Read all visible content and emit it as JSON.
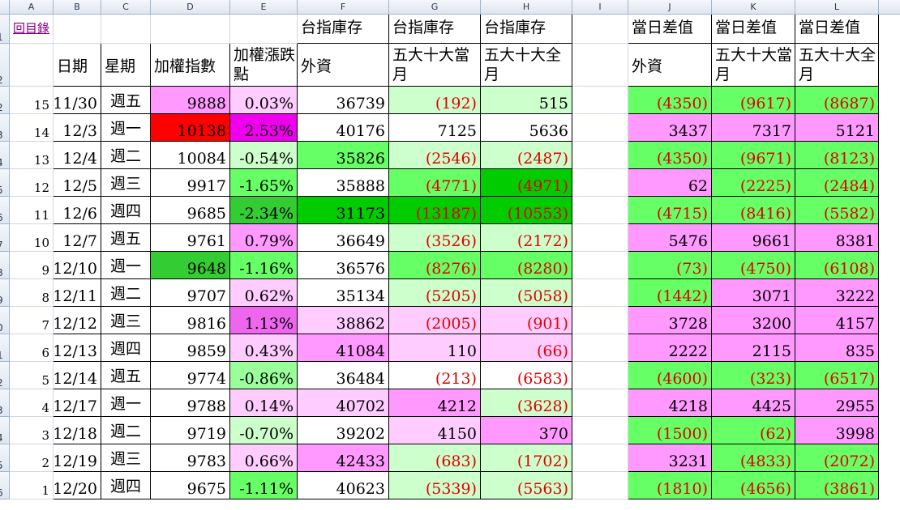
{
  "col_headers": [
    "A",
    "B",
    "C",
    "D",
    "E",
    "F",
    "G",
    "H",
    "I",
    "J",
    "K",
    "L"
  ],
  "row_headers": [
    "1",
    "2",
    "2",
    "3",
    "4",
    "5",
    "6",
    "7",
    "8",
    "9",
    "0",
    "1",
    "2",
    "3",
    "4",
    "5",
    "6"
  ],
  "link_label": "回目錄",
  "group_headers": {
    "F": "台指庫存",
    "G": "台指庫存",
    "H": "台指庫存",
    "J": "當日差值",
    "K": "當日差值",
    "L": "當日差值"
  },
  "sub_headers": {
    "B": "日期",
    "C": "星期",
    "D": "加權指數",
    "E": "加權漲跌點",
    "F": "外資",
    "G": "五大十大當月",
    "H": "五大十大全月",
    "J": "外資",
    "K": "五大十大當月",
    "L": "五大十大全月"
  },
  "colors": {
    "pink": "#ff99ff",
    "light_pink": "#ffccff",
    "magenta": "#ee00ee",
    "red": "#ff0000",
    "green": "#66ff66",
    "light_green": "#ccffcc",
    "dark_green": "#00cc00",
    "mid_green": "#33cc33",
    "negative_text": "#e00000"
  },
  "rows": [
    {
      "idx": "15",
      "date": "11/30",
      "day": "週五",
      "index": "9888",
      "change": "0.03%",
      "foreign": "36739",
      "g": "(192)",
      "h": "515",
      "j": "(4350)",
      "k": "(9617)",
      "l": "(8687)"
    },
    {
      "idx": "14",
      "date": "12/3",
      "day": "週一",
      "index": "10138",
      "change": "2.53%",
      "foreign": "40176",
      "g": "7125",
      "h": "5636",
      "j": "3437",
      "k": "7317",
      "l": "5121"
    },
    {
      "idx": "13",
      "date": "12/4",
      "day": "週二",
      "index": "10084",
      "change": "-0.54%",
      "foreign": "35826",
      "g": "(2546)",
      "h": "(2487)",
      "j": "(4350)",
      "k": "(9671)",
      "l": "(8123)"
    },
    {
      "idx": "12",
      "date": "12/5",
      "day": "週三",
      "index": "9917",
      "change": "-1.65%",
      "foreign": "35888",
      "g": "(4771)",
      "h": "(4971)",
      "j": "62",
      "k": "(2225)",
      "l": "(2484)"
    },
    {
      "idx": "11",
      "date": "12/6",
      "day": "週四",
      "index": "9685",
      "change": "-2.34%",
      "foreign": "31173",
      "g": "(13187)",
      "h": "(10553)",
      "j": "(4715)",
      "k": "(8416)",
      "l": "(5582)"
    },
    {
      "idx": "10",
      "date": "12/7",
      "day": "週五",
      "index": "9761",
      "change": "0.79%",
      "foreign": "36649",
      "g": "(3526)",
      "h": "(2172)",
      "j": "5476",
      "k": "9661",
      "l": "8381"
    },
    {
      "idx": "9",
      "date": "12/10",
      "day": "週一",
      "index": "9648",
      "change": "-1.16%",
      "foreign": "36576",
      "g": "(8276)",
      "h": "(8280)",
      "j": "(73)",
      "k": "(4750)",
      "l": "(6108)"
    },
    {
      "idx": "8",
      "date": "12/11",
      "day": "週二",
      "index": "9707",
      "change": "0.62%",
      "foreign": "35134",
      "g": "(5205)",
      "h": "(5058)",
      "j": "(1442)",
      "k": "3071",
      "l": "3222"
    },
    {
      "idx": "7",
      "date": "12/12",
      "day": "週三",
      "index": "9816",
      "change": "1.13%",
      "foreign": "38862",
      "g": "(2005)",
      "h": "(901)",
      "j": "3728",
      "k": "3200",
      "l": "4157"
    },
    {
      "idx": "6",
      "date": "12/13",
      "day": "週四",
      "index": "9859",
      "change": "0.43%",
      "foreign": "41084",
      "g": "110",
      "h": "(66)",
      "j": "2222",
      "k": "2115",
      "l": "835"
    },
    {
      "idx": "5",
      "date": "12/14",
      "day": "週五",
      "index": "9774",
      "change": "-0.86%",
      "foreign": "36484",
      "g": "(213)",
      "h": "(6583)",
      "j": "(4600)",
      "k": "(323)",
      "l": "(6517)"
    },
    {
      "idx": "4",
      "date": "12/17",
      "day": "週一",
      "index": "9788",
      "change": "0.14%",
      "foreign": "40702",
      "g": "4212",
      "h": "(3628)",
      "j": "4218",
      "k": "4425",
      "l": "2955"
    },
    {
      "idx": "3",
      "date": "12/18",
      "day": "週二",
      "index": "9719",
      "change": "-0.70%",
      "foreign": "39202",
      "g": "4150",
      "h": "370",
      "j": "(1500)",
      "k": "(62)",
      "l": "3998"
    },
    {
      "idx": "2",
      "date": "12/19",
      "day": "週三",
      "index": "9783",
      "change": "0.66%",
      "foreign": "42433",
      "g": "(683)",
      "h": "(1702)",
      "j": "3231",
      "k": "(4833)",
      "l": "(2072)"
    },
    {
      "idx": "1",
      "date": "12/20",
      "day": "週四",
      "index": "9675",
      "change": "-1.11%",
      "foreign": "40623",
      "g": "(5339)",
      "h": "(5563)",
      "j": "(1810)",
      "k": "(4656)",
      "l": "(3861)"
    }
  ],
  "fills": [
    {
      "D": "#ff99ff",
      "E": "#ffccff",
      "G": "#ccffcc",
      "H": "#ccffcc",
      "J": "#66ff66",
      "K": "#66ff66",
      "L": "#66ff66"
    },
    {
      "D": "#ff0000",
      "E": "#ee00ee",
      "J": "#ff99ff",
      "K": "#ff99ff",
      "L": "#ff99ff"
    },
    {
      "E": "#ccffcc",
      "F": "#66ff66",
      "G": "#ccffcc",
      "H": "#ccffcc",
      "J": "#66ff66",
      "K": "#66ff66",
      "L": "#66ff66"
    },
    {
      "E": "#66ff66",
      "G": "#66ff66",
      "H": "#00cc00",
      "J": "#ff99ff",
      "K": "#66ff66",
      "L": "#66ff66"
    },
    {
      "E": "#33cc33",
      "F": "#00cc00",
      "G": "#00cc00",
      "H": "#00cc00",
      "J": "#66ff66",
      "K": "#66ff66",
      "L": "#66ff66"
    },
    {
      "E": "#ff99ff",
      "G": "#ccffcc",
      "H": "#ccffcc",
      "J": "#ff99ff",
      "K": "#ff99ff",
      "L": "#ff99ff"
    },
    {
      "D": "#33cc33",
      "E": "#66ff66",
      "G": "#66ff66",
      "H": "#66ff66",
      "J": "#66ff66",
      "K": "#66ff66",
      "L": "#66ff66"
    },
    {
      "E": "#ffccff",
      "G": "#ccffcc",
      "H": "#ccffcc",
      "J": "#66ff66",
      "K": "#ff99ff",
      "L": "#ff99ff"
    },
    {
      "E": "#ee66ee",
      "F": "#ffccff",
      "G": "#ffccff",
      "H": "#ffccff",
      "J": "#ff99ff",
      "K": "#ff99ff",
      "L": "#ff99ff"
    },
    {
      "E": "#ffccff",
      "F": "#ff99ff",
      "G": "#ffccff",
      "H": "#ffccff",
      "J": "#ff99ff",
      "K": "#ff99ff",
      "L": "#ff99ff"
    },
    {
      "E": "#99ff99",
      "J": "#66ff66",
      "K": "#66ff66",
      "L": "#66ff66"
    },
    {
      "E": "#ffccff",
      "F": "#ffccff",
      "G": "#ff99ff",
      "H": "#ccffcc",
      "J": "#ff99ff",
      "K": "#ff99ff",
      "L": "#ff99ff"
    },
    {
      "E": "#ccffcc",
      "G": "#ffccff",
      "H": "#ff99ff",
      "J": "#66ff66",
      "K": "#66ff66",
      "L": "#ff99ff"
    },
    {
      "E": "#ffccff",
      "F": "#ff99ff",
      "G": "#ccffcc",
      "H": "#ccffcc",
      "J": "#ff99ff",
      "K": "#66ff66",
      "L": "#66ff66"
    },
    {
      "E": "#66ff66",
      "G": "#ccffcc",
      "H": "#ccffcc",
      "J": "#66ff66",
      "K": "#66ff66",
      "L": "#66ff66"
    }
  ]
}
